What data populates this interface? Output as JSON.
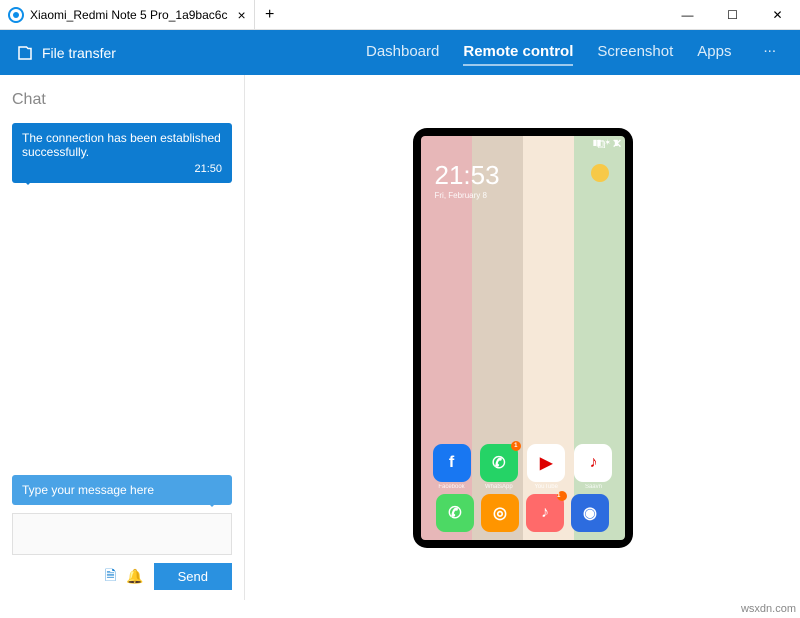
{
  "window": {
    "tab_title": "Xiaomi_Redmi Note 5 Pro_1a9bac6c"
  },
  "toolbar": {
    "file_transfer": "File transfer",
    "nav": {
      "dashboard": "Dashboard",
      "remote": "Remote control",
      "screenshot": "Screenshot",
      "apps": "Apps",
      "more": "..."
    }
  },
  "chat": {
    "title": "Chat",
    "system_msg": "The connection has been established successfully.",
    "system_time": "21:50",
    "hint": "Type your message here",
    "send": "Send"
  },
  "phone": {
    "clock": "21:53",
    "date": "Fri, February 8",
    "apps_row": [
      {
        "name": "Facebook",
        "label": "Facebook",
        "bg": "#1877f2",
        "glyph": "f",
        "badge": ""
      },
      {
        "name": "WhatsApp",
        "label": "WhatsApp",
        "bg": "#25d366",
        "glyph": "✆",
        "badge": "1"
      },
      {
        "name": "YouTube",
        "label": "YouTube",
        "bg": "#ffffff",
        "glyph": "▶",
        "badge": ""
      },
      {
        "name": "Saavn",
        "label": "Saavn",
        "bg": "#ffffff",
        "glyph": "♪",
        "badge": ""
      }
    ],
    "dock": [
      {
        "name": "Phone",
        "bg": "#4cd964",
        "glyph": "✆"
      },
      {
        "name": "Browser",
        "bg": "#ff9500",
        "glyph": "◎"
      },
      {
        "name": "Music",
        "bg": "#ff6a6a",
        "glyph": "♪",
        "badge": "1"
      },
      {
        "name": "Camera",
        "bg": "#2d6cdf",
        "glyph": "◉"
      }
    ]
  },
  "watermark": "wsxdn.com"
}
